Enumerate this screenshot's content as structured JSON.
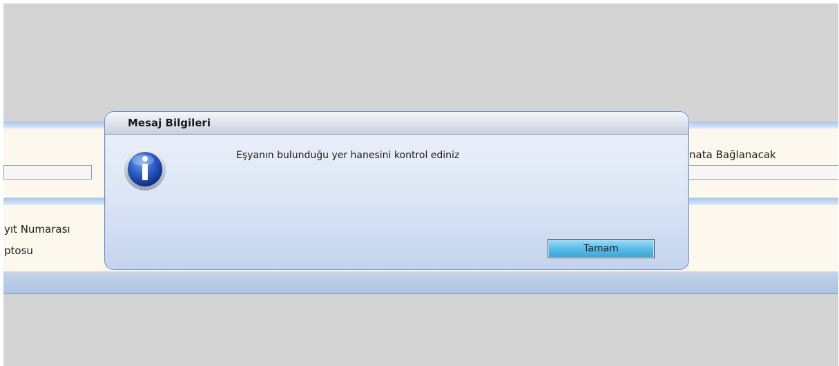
{
  "background": {
    "right_label": "nata Bağlanacak",
    "kayit_label": "yıt Numarası",
    "makbuz_label": "ptosu"
  },
  "dialog": {
    "title": "Mesaj Bilgileri",
    "icon": "info-icon",
    "message": "Eşyanın bulunduğu yer hanesini kontrol ediniz",
    "ok_label": "Tamam"
  },
  "colors": {
    "accent_band": "#a9c7ee",
    "panel": "#fcf8ee",
    "button": "#5bbde8",
    "icon_blue": "#1f4fb8"
  }
}
